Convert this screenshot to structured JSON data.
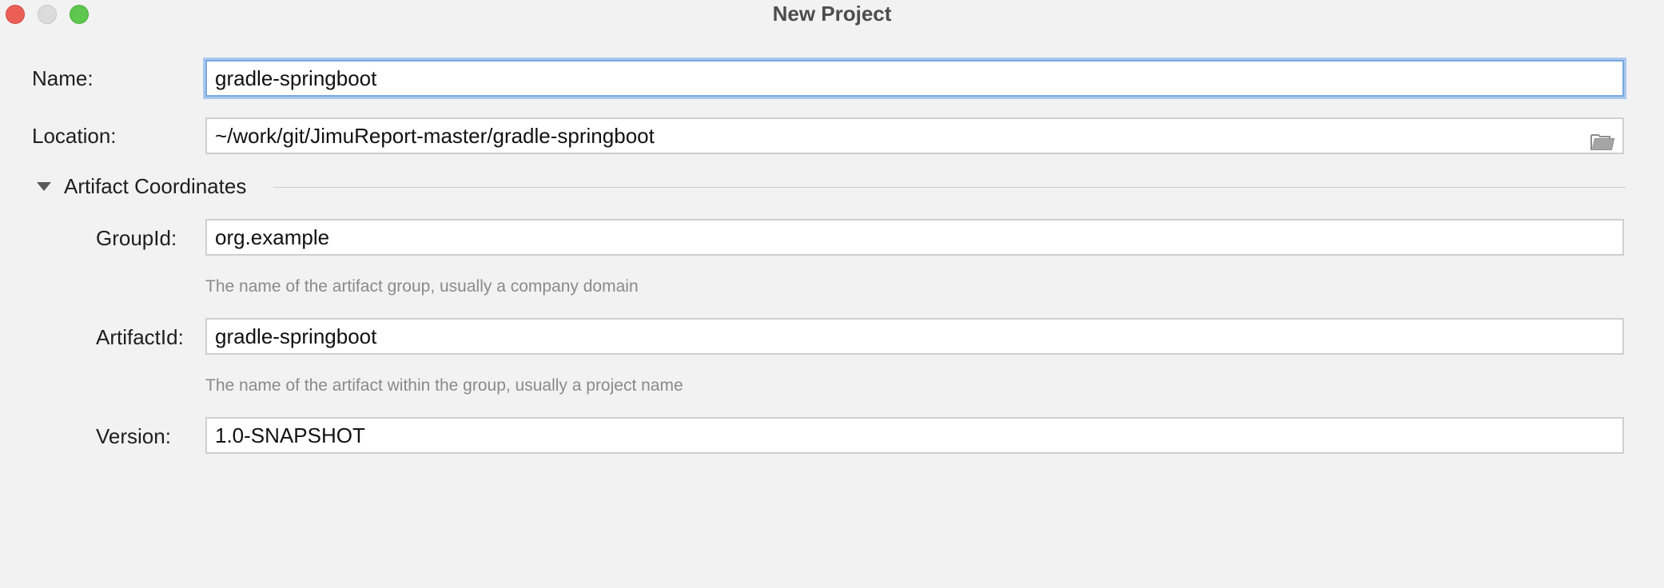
{
  "window": {
    "title": "New Project"
  },
  "form": {
    "name": {
      "label": "Name:",
      "value": "gradle-springboot"
    },
    "location": {
      "label": "Location:",
      "value": "~/work/git/JimuReport-master/gradle-springboot",
      "browse_icon": "folder-icon"
    },
    "artifact_section": {
      "title": "Artifact Coordinates",
      "expanded": true,
      "group_id": {
        "label": "GroupId:",
        "value": "org.example",
        "hint": "The name of the artifact group, usually a company domain"
      },
      "artifact_id": {
        "label": "ArtifactId:",
        "value": "gradle-springboot",
        "hint": "The name of the artifact within the group, usually a project name"
      },
      "version": {
        "label": "Version:",
        "value": "1.0-SNAPSHOT"
      }
    }
  },
  "colors": {
    "focus_border": "#7aa7df",
    "close": "#ec5f57",
    "zoom": "#5fc650"
  }
}
